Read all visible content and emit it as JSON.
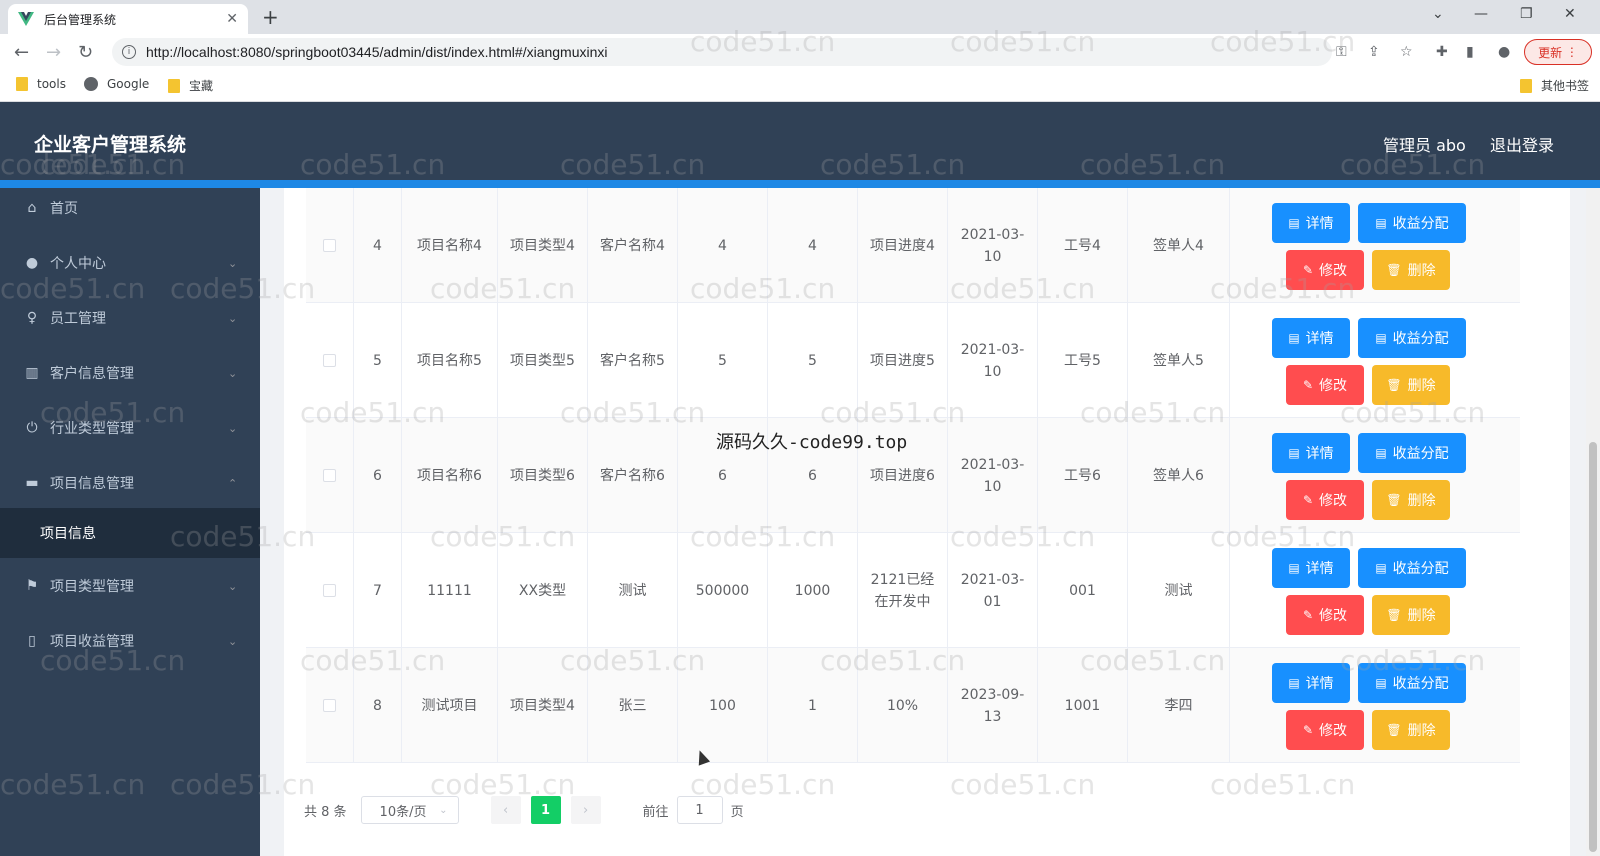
{
  "browser": {
    "tab_title": "后台管理系统",
    "url": "http://localhost:8080/springboot03445/admin/dist/index.html#/xiangmuxinxi",
    "update_label": "更新",
    "bookmarks": [
      "tools",
      "Google",
      "宝藏"
    ],
    "other_bookmarks": "其他书签"
  },
  "header": {
    "title": "企业客户管理系统",
    "user": "管理员 abo",
    "logout": "退出登录"
  },
  "sidebar": {
    "items": [
      {
        "label": "首页",
        "icon": "home-icon"
      },
      {
        "label": "个人中心",
        "icon": "user-icon"
      },
      {
        "label": "员工管理",
        "icon": "mic-icon"
      },
      {
        "label": "客户信息管理",
        "icon": "chart-icon"
      },
      {
        "label": "行业类型管理",
        "icon": "power-icon"
      },
      {
        "label": "项目信息管理",
        "icon": "briefcase-icon"
      },
      {
        "label": "项目类型管理",
        "icon": "flag-icon"
      },
      {
        "label": "项目收益管理",
        "icon": "phone-icon"
      }
    ],
    "submenu": "项目信息"
  },
  "table": {
    "rows": [
      {
        "no": "4",
        "name": "项目名称4",
        "type": "项目类型4",
        "customer": "客户名称4",
        "amount": "4",
        "period": "4",
        "progress": "项目进度4",
        "date": "2021-03-10",
        "worker": "工号4",
        "signer": "签单人4"
      },
      {
        "no": "5",
        "name": "项目名称5",
        "type": "项目类型5",
        "customer": "客户名称5",
        "amount": "5",
        "period": "5",
        "progress": "项目进度5",
        "date": "2021-03-10",
        "worker": "工号5",
        "signer": "签单人5"
      },
      {
        "no": "6",
        "name": "项目名称6",
        "type": "项目类型6",
        "customer": "客户名称6",
        "amount": "6",
        "period": "6",
        "progress": "项目进度6",
        "date": "2021-03-10",
        "worker": "工号6",
        "signer": "签单人6"
      },
      {
        "no": "7",
        "name": "11111",
        "type": "XX类型",
        "customer": "测试",
        "amount": "500000",
        "period": "1000",
        "progress": "2121已经在开发中",
        "date": "2021-03-01",
        "worker": "001",
        "signer": "测试"
      },
      {
        "no": "8",
        "name": "测试项目",
        "type": "项目类型4",
        "customer": "张三",
        "amount": "100",
        "period": "1",
        "progress": "10%",
        "date": "2023-09-13",
        "worker": "1001",
        "signer": "李四"
      }
    ],
    "buttons": {
      "detail": "详情",
      "income": "收益分配",
      "edit": "修改",
      "delete": "删除"
    }
  },
  "pagination": {
    "total": "共 8 条",
    "page_size": "10条/页",
    "current": "1",
    "goto_label": "前往",
    "goto_value": "1",
    "page_unit": "页"
  },
  "watermark": "code51.cn",
  "overlay": "源码久久-code99.top"
}
